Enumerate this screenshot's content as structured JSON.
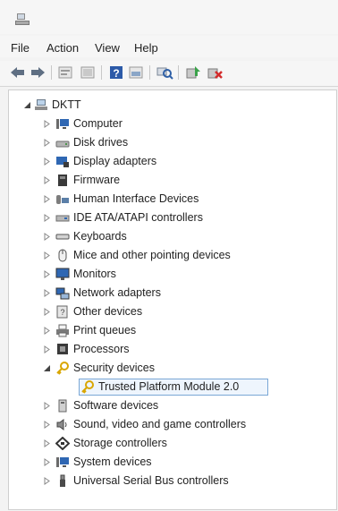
{
  "menu": {
    "file": "File",
    "action": "Action",
    "view": "View",
    "help": "Help"
  },
  "toolbar": {
    "buttons": [
      "back-arrow-icon",
      "forward-arrow-icon",
      "properties-icon",
      "show-hide-icon",
      "help-icon",
      "view-icon",
      "scan-hardware-icon",
      "update-driver-icon",
      "uninstall-icon"
    ]
  },
  "tree": {
    "root": "DKTT",
    "nodes": [
      {
        "label": "Computer",
        "icon": "computer-icon"
      },
      {
        "label": "Disk drives",
        "icon": "disk-drive-icon"
      },
      {
        "label": "Display adapters",
        "icon": "display-adapter-icon"
      },
      {
        "label": "Firmware",
        "icon": "firmware-icon"
      },
      {
        "label": "Human Interface Devices",
        "icon": "hid-icon"
      },
      {
        "label": "IDE ATA/ATAPI controllers",
        "icon": "ide-controller-icon"
      },
      {
        "label": "Keyboards",
        "icon": "keyboard-icon"
      },
      {
        "label": "Mice and other pointing devices",
        "icon": "mouse-icon"
      },
      {
        "label": "Monitors",
        "icon": "monitor-icon"
      },
      {
        "label": "Network adapters",
        "icon": "network-adapter-icon"
      },
      {
        "label": "Other devices",
        "icon": "other-devices-icon"
      },
      {
        "label": "Print queues",
        "icon": "printer-icon"
      },
      {
        "label": "Processors",
        "icon": "processor-icon"
      },
      {
        "label": "Security devices",
        "icon": "security-key-icon",
        "expanded": true
      },
      {
        "label": "Trusted Platform Module 2.0",
        "icon": "security-key-icon",
        "child": true,
        "selected": true
      },
      {
        "label": "Software devices",
        "icon": "software-device-icon"
      },
      {
        "label": "Sound, video and game controllers",
        "icon": "speaker-icon"
      },
      {
        "label": "Storage controllers",
        "icon": "storage-controller-icon"
      },
      {
        "label": "System devices",
        "icon": "system-devices-icon"
      },
      {
        "label": "Universal Serial Bus controllers",
        "icon": "usb-icon"
      }
    ]
  }
}
